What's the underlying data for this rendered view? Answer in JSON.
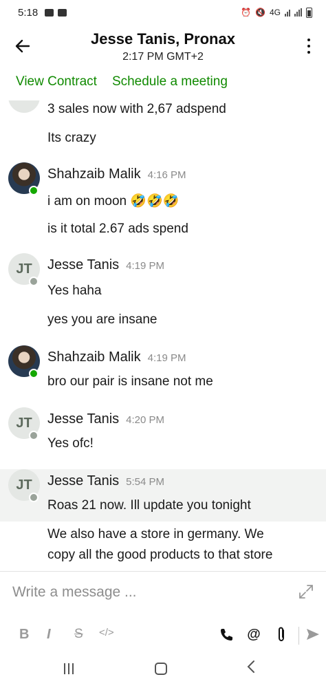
{
  "status_bar": {
    "time": "5:18",
    "network": "4G",
    "colors": {
      "icon": "#333333"
    }
  },
  "header": {
    "back_icon": "arrow-left-icon",
    "title": "Jesse Tanis, Pronax",
    "subtitle": "2:17 PM GMT+2",
    "menu_icon": "kebab-menu-icon"
  },
  "actions": {
    "view_contract": "View Contract",
    "schedule_meeting": "Schedule a meeting",
    "color": "#108a00"
  },
  "messages": [
    {
      "lines": [
        "3 sales now with 2,67 adspend",
        "Its crazy"
      ]
    },
    {
      "sender": "Shahzaib Malik",
      "time": "4:16 PM",
      "avatar": "photo",
      "status": "online",
      "lines": [
        "i am on moon 🤣🤣🤣",
        "is it total 2.67 ads spend"
      ]
    },
    {
      "sender": "Jesse Tanis",
      "time": "4:19 PM",
      "avatar": "JT",
      "status": "away",
      "lines": [
        "Yes haha",
        "yes you are insane"
      ]
    },
    {
      "sender": "Shahzaib Malik",
      "time": "4:19 PM",
      "avatar": "photo",
      "status": "online",
      "lines": [
        "bro our pair is insane not me"
      ]
    },
    {
      "sender": "Jesse Tanis",
      "time": "4:20 PM",
      "avatar": "JT",
      "status": "away",
      "lines": [
        "Yes ofc!"
      ]
    },
    {
      "sender": "Jesse Tanis",
      "time": "5:54 PM",
      "avatar": "JT",
      "status": "away",
      "highlighted": true,
      "lines": [
        "Roas 21 now. Ill update you tonight",
        "We also have a store in germany. We",
        "copy all the good products to that store"
      ]
    }
  ],
  "composer": {
    "placeholder": "Write a message ...",
    "format_buttons": {
      "bold": "B",
      "italic": "I",
      "strike": "S",
      "code": "</>"
    },
    "icons": [
      "expand-icon",
      "phone-icon",
      "mention-icon",
      "paperclip-icon",
      "send-icon"
    ]
  },
  "nav_bar": {
    "icons": [
      "recent-apps-icon",
      "home-icon",
      "back-icon"
    ]
  }
}
